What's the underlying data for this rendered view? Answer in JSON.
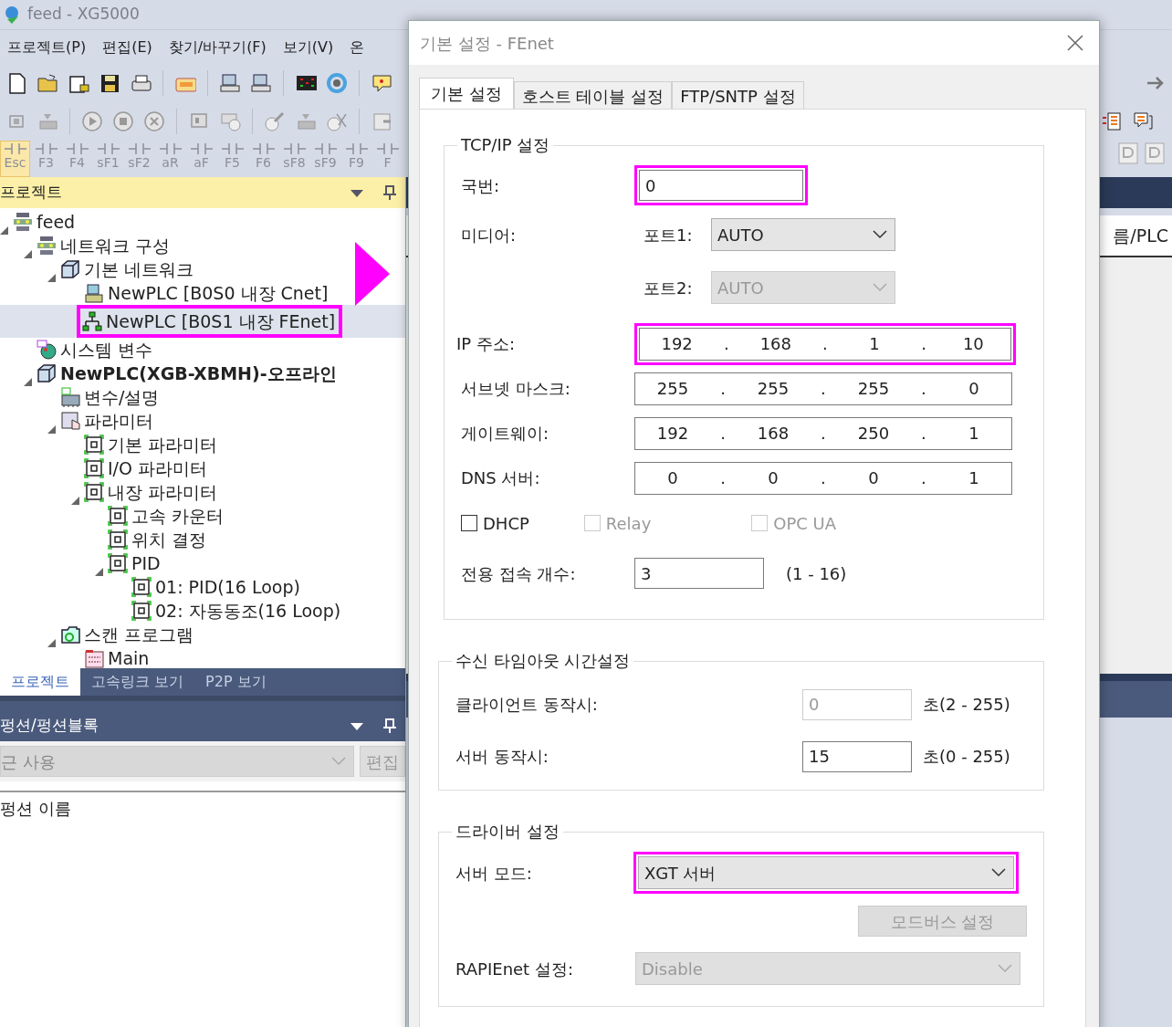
{
  "app": {
    "title": "feed - XG5000",
    "menu": [
      "프로젝트(P)",
      "편집(E)",
      "찾기/바꾸기(F)",
      "보기(V)",
      "온"
    ],
    "ladder_keys": [
      {
        "label": "Esc",
        "selected": true
      },
      {
        "label": "F3",
        "selected": false
      },
      {
        "label": "F4",
        "selected": false
      },
      {
        "label": "sF1",
        "selected": false
      },
      {
        "label": "sF2",
        "selected": false
      },
      {
        "label": "aR",
        "selected": false
      },
      {
        "label": "aF",
        "selected": false
      },
      {
        "label": "F5",
        "selected": false
      },
      {
        "label": "F6",
        "selected": false
      },
      {
        "label": "sF8",
        "selected": false
      },
      {
        "label": "sF9",
        "selected": false
      },
      {
        "label": "F9",
        "selected": false
      },
      {
        "label": "F",
        "selected": false
      }
    ]
  },
  "project_panel": {
    "title": "프로젝트",
    "tree": [
      {
        "label": "feed",
        "kind": "network",
        "expanded": true,
        "selected": false,
        "highlighted": false,
        "children": [
          {
            "label": "네트워크 구성",
            "kind": "network",
            "expanded": true,
            "selected": false,
            "highlighted": false,
            "children": [
              {
                "label": "기본 네트워크",
                "kind": "module",
                "expanded": true,
                "selected": false,
                "highlighted": false,
                "children": [
                  {
                    "label": "NewPLC [B0S0 내장 Cnet]",
                    "kind": "cnet",
                    "selected": false,
                    "highlighted": false
                  },
                  {
                    "label": "NewPLC [B0S1 내장 FEnet]",
                    "kind": "fenet",
                    "selected": true,
                    "highlighted": true
                  }
                ]
              }
            ]
          },
          {
            "label": "시스템 변수",
            "kind": "sysvar",
            "selected": false,
            "highlighted": false
          },
          {
            "label": "NewPLC(XGB-XBMH)-오프라인",
            "kind": "plc",
            "expanded": true,
            "selected": false,
            "highlighted": false,
            "children": [
              {
                "label": "변수/설명",
                "kind": "vars",
                "selected": false,
                "highlighted": false
              },
              {
                "label": "파라미터",
                "kind": "param",
                "expanded": true,
                "selected": false,
                "highlighted": false,
                "children": [
                  {
                    "label": "기본 파라미터",
                    "kind": "paramitem",
                    "selected": false,
                    "highlighted": false
                  },
                  {
                    "label": "I/O 파라미터",
                    "kind": "paramitem",
                    "selected": false,
                    "highlighted": false
                  },
                  {
                    "label": "내장 파라미터",
                    "kind": "paramitem",
                    "expanded": true,
                    "selected": false,
                    "highlighted": false,
                    "children": [
                      {
                        "label": "고속 카운터",
                        "kind": "paramitem",
                        "selected": false,
                        "highlighted": false
                      },
                      {
                        "label": "위치 결정",
                        "kind": "paramitem",
                        "selected": false,
                        "highlighted": false
                      },
                      {
                        "label": "PID",
                        "kind": "paramitem",
                        "expanded": true,
                        "selected": false,
                        "highlighted": false,
                        "children": [
                          {
                            "label": "01: PID(16 Loop)",
                            "kind": "paramitem",
                            "selected": false,
                            "highlighted": false
                          },
                          {
                            "label": "02: 자동동조(16 Loop)",
                            "kind": "paramitem",
                            "selected": false,
                            "highlighted": false
                          }
                        ]
                      }
                    ]
                  }
                ]
              },
              {
                "label": "스캔 프로그램",
                "kind": "program",
                "expanded": true,
                "selected": false,
                "highlighted": false,
                "children": [
                  {
                    "label": "Main",
                    "kind": "file",
                    "selected": false,
                    "highlighted": false
                  }
                ]
              }
            ]
          }
        ]
      }
    ]
  },
  "panel_tabs": [
    {
      "label": "프로젝트",
      "selected": true
    },
    {
      "label": "고속링크 보기",
      "selected": false
    },
    {
      "label": "P2P 보기",
      "selected": false
    }
  ],
  "function_panel": {
    "title": "펑션/펑션블록",
    "filter": "근 사용",
    "edit_button": "편집",
    "column": "펑션 이름"
  },
  "right_pane": {
    "column": "름/PLC"
  },
  "dialog": {
    "title": "기본 설정 - FEnet",
    "tabs": [
      {
        "label": "기본 설정",
        "selected": true
      },
      {
        "label": "호스트 테이블 설정",
        "selected": false
      },
      {
        "label": "FTP/SNTP 설정",
        "selected": false
      }
    ],
    "tcpip": {
      "title": "TCP/IP 설정",
      "station": {
        "label": "국번:",
        "value": "0",
        "highlighted": true
      },
      "media": {
        "label": "미디어:",
        "ports": [
          {
            "label": "포트1:",
            "value": "AUTO",
            "disabled": false
          },
          {
            "label": "포트2:",
            "value": "AUTO",
            "disabled": true
          }
        ]
      },
      "addresses": [
        {
          "label": "IP 주소:",
          "octets": [
            "192",
            "168",
            "1",
            "10"
          ],
          "separator": ".",
          "highlighted": true
        },
        {
          "label": "서브넷 마스크:",
          "octets": [
            "255",
            "255",
            "255",
            "0"
          ],
          "separator": ".",
          "highlighted": false
        },
        {
          "label": "게이트웨이:",
          "octets": [
            "192",
            "168",
            "250",
            "1"
          ],
          "separator": ".",
          "highlighted": false
        },
        {
          "label": "DNS 서버:",
          "octets": [
            "0",
            "0",
            "0",
            "1"
          ],
          "separator": ".",
          "highlighted": false
        }
      ],
      "checkboxes": [
        {
          "label": "DHCP",
          "checked": false,
          "disabled": false
        },
        {
          "label": "Relay",
          "checked": false,
          "disabled": true
        },
        {
          "label": "OPC UA",
          "checked": false,
          "disabled": true
        }
      ],
      "connections": {
        "label": "전용 접속 개수:",
        "value": "3",
        "range": "(1 - 16)"
      }
    },
    "timeout": {
      "title": "수신 타임아웃 시간설정",
      "rows": [
        {
          "label": "클라이언트 동작시:",
          "value": "0",
          "disabled": true,
          "range": "초(2 - 255)"
        },
        {
          "label": "서버 동작시:",
          "value": "15",
          "disabled": false,
          "range": "초(0 - 255)"
        }
      ]
    },
    "driver": {
      "title": "드라이버 설정",
      "server_mode": {
        "label": "서버 모드:",
        "value": "XGT 서버",
        "highlighted": true
      },
      "modbus_button": {
        "label": "모드버스 설정",
        "disabled": true
      },
      "rapienet": {
        "label": "RAPIEnet 설정:",
        "value": "Disable",
        "disabled": true
      }
    }
  }
}
